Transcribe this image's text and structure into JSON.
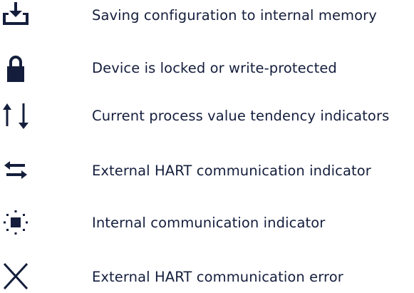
{
  "legend": {
    "items": [
      {
        "icon": "save-to-memory-icon",
        "label": "Saving configuration to internal memory"
      },
      {
        "icon": "lock-icon",
        "label": "Device is locked or write-protected"
      },
      {
        "icon": "tendency-arrows-icon",
        "label": "Current process value tendency indicators"
      },
      {
        "icon": "hart-communication-icon",
        "label": "External HART communication indicator"
      },
      {
        "icon": "internal-communication-icon",
        "label": "Internal communication indicator"
      },
      {
        "icon": "communication-error-icon",
        "label": "External HART communication error"
      }
    ]
  },
  "colors": {
    "text": "#141e3c",
    "icon": "#141e3c",
    "background": "#ffffff"
  }
}
